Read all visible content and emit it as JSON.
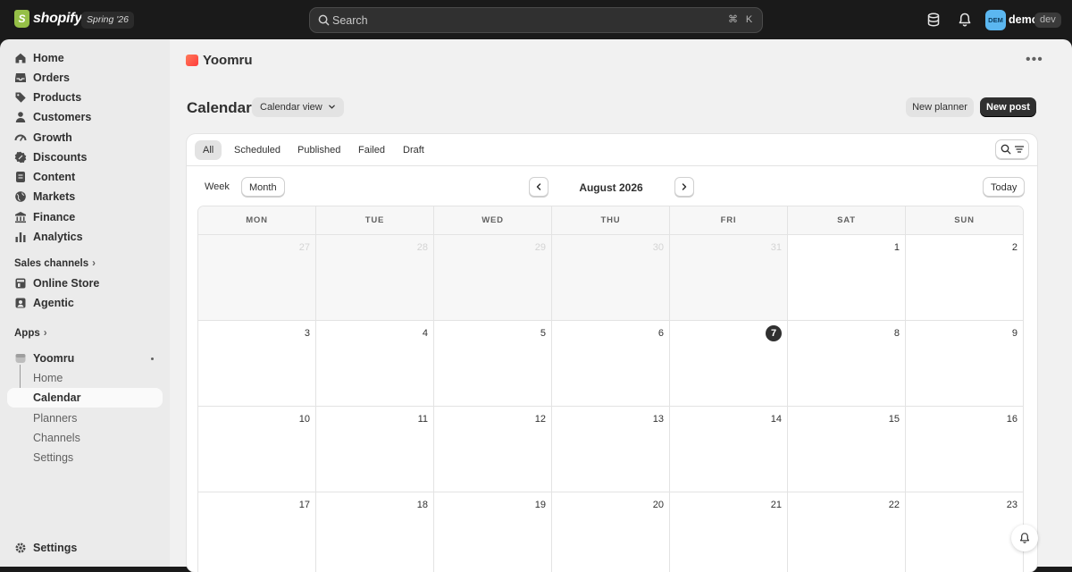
{
  "topbar": {
    "brand": "shopify",
    "edition": "Spring '26",
    "search_placeholder": "Search",
    "shortcut_keys": [
      "⌘",
      "K"
    ],
    "avatar_initials": "DEM",
    "user_name": "demo",
    "user_badge": "dev",
    "avatar_color": "#5bb7f0"
  },
  "sidebar": {
    "items": [
      {
        "label": "Home",
        "icon": "home-icon"
      },
      {
        "label": "Orders",
        "icon": "inbox-icon"
      },
      {
        "label": "Products",
        "icon": "tag-icon"
      },
      {
        "label": "Customers",
        "icon": "person-icon"
      },
      {
        "label": "Growth",
        "icon": "gauge-icon"
      },
      {
        "label": "Discounts",
        "icon": "discount-icon"
      },
      {
        "label": "Content",
        "icon": "document-icon"
      },
      {
        "label": "Markets",
        "icon": "globe-icon"
      },
      {
        "label": "Finance",
        "icon": "bank-icon"
      },
      {
        "label": "Analytics",
        "icon": "bar-chart-icon"
      }
    ],
    "sales_channels_label": "Sales channels",
    "sales_channels": [
      {
        "label": "Online Store",
        "icon": "store-icon"
      },
      {
        "label": "Agentic",
        "icon": "agent-icon"
      }
    ],
    "apps_label": "Apps",
    "app": {
      "label": "Yoomru",
      "sub_items": [
        "Home",
        "Calendar",
        "Planners",
        "Channels",
        "Settings"
      ],
      "active_sub_item": "Calendar"
    },
    "settings_label": "Settings"
  },
  "main": {
    "app_name": "Yoomru",
    "page_title": "Calendar",
    "view_dropdown": "Calendar view",
    "new_planner_label": "New planner",
    "new_post_label": "New post",
    "filter_tabs": [
      "All",
      "Scheduled",
      "Published",
      "Failed",
      "Draft"
    ],
    "active_filter": "All",
    "week_label": "Week",
    "month_label_btn": "Month",
    "month_title": "August 2026",
    "today_label": "Today",
    "weekdays": [
      "MON",
      "TUE",
      "WED",
      "THU",
      "FRI",
      "SAT",
      "SUN"
    ],
    "weeks": [
      [
        {
          "d": "27",
          "out": true
        },
        {
          "d": "28",
          "out": true
        },
        {
          "d": "29",
          "out": true
        },
        {
          "d": "30",
          "out": true
        },
        {
          "d": "31",
          "out": true
        },
        {
          "d": "1"
        },
        {
          "d": "2"
        }
      ],
      [
        {
          "d": "3"
        },
        {
          "d": "4"
        },
        {
          "d": "5"
        },
        {
          "d": "6"
        },
        {
          "d": "7",
          "today": true
        },
        {
          "d": "8"
        },
        {
          "d": "9"
        }
      ],
      [
        {
          "d": "10"
        },
        {
          "d": "11"
        },
        {
          "d": "12"
        },
        {
          "d": "13"
        },
        {
          "d": "14"
        },
        {
          "d": "15"
        },
        {
          "d": "16"
        }
      ],
      [
        {
          "d": "17"
        },
        {
          "d": "18"
        },
        {
          "d": "19"
        },
        {
          "d": "20"
        },
        {
          "d": "21"
        },
        {
          "d": "22"
        },
        {
          "d": "23"
        }
      ]
    ]
  },
  "colors": {
    "primary_button": "#303030",
    "sidebar_bg": "#ebebeb",
    "page_bg": "#f1f1f1"
  }
}
